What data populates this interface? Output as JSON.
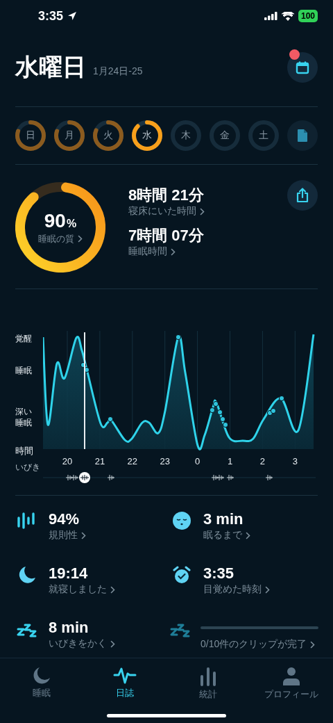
{
  "status_bar": {
    "time": "3:35",
    "battery": "100"
  },
  "header": {
    "title": "水曜日",
    "date_range": "1月24日-25",
    "notification": true
  },
  "days": [
    {
      "label": "日",
      "level": 0.85,
      "selected": false
    },
    {
      "label": "月",
      "level": 0.85,
      "selected": false
    },
    {
      "label": "火",
      "level": 0.86,
      "selected": false
    },
    {
      "label": "水",
      "level": 0.92,
      "selected": true
    },
    {
      "label": "木",
      "selected": false
    },
    {
      "label": "金",
      "selected": false
    },
    {
      "label": "土",
      "selected": false
    }
  ],
  "summary": {
    "quality": {
      "value": "90",
      "unit": "%",
      "label": "睡眠の質",
      "level": 0.9
    },
    "stats": [
      {
        "value": "8時間 21分",
        "label": "寝床にいた時間"
      },
      {
        "value": "7時間 07分",
        "label": "睡眠時間"
      }
    ]
  },
  "chart": {
    "y_labels": [
      "覚醒",
      "睡眠",
      "深い睡眠"
    ],
    "x_axis_label": "時間",
    "x_ticks": [
      "20",
      "21",
      "22",
      "23",
      "0",
      "1",
      "2",
      "3"
    ],
    "snore_label": "いびき"
  },
  "metrics": [
    {
      "kind": "stat",
      "value": "94%",
      "label": "規則性"
    },
    {
      "kind": "stat",
      "value": "3 min",
      "label": "眠るまで"
    },
    {
      "kind": "stat",
      "value": "19:14",
      "label": "就寝しました"
    },
    {
      "kind": "stat",
      "value": "3:35",
      "label": "目覚めた時刻"
    },
    {
      "kind": "stat",
      "value": "8 min",
      "label": "いびきをかく"
    },
    {
      "kind": "progress",
      "label": "0/10件のクリップが完了"
    }
  ],
  "tabs": [
    {
      "label": "睡眠",
      "selected": false
    },
    {
      "label": "日誌",
      "selected": true
    },
    {
      "label": "統計",
      "selected": false
    },
    {
      "label": "プロフィール",
      "selected": false
    }
  ]
}
